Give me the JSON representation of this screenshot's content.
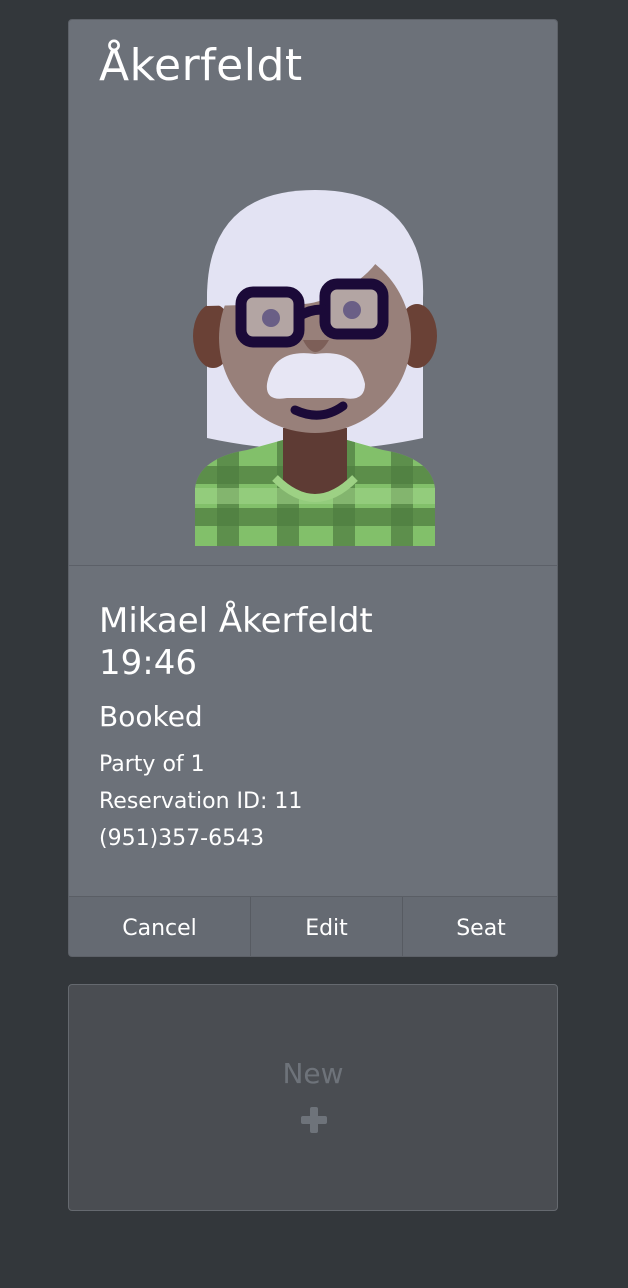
{
  "reservation_card": {
    "title": "Åkerfeldt",
    "guest_name": "Mikael Åkerfeldt",
    "time": "19:46",
    "status": "Booked",
    "party": "Party of 1",
    "reservation_id": "Reservation ID: 11",
    "phone": "(951)357-6543",
    "avatar_icon": "elderly-man-avatar-icon",
    "actions": {
      "cancel": "Cancel",
      "edit": "Edit",
      "seat": "Seat"
    }
  },
  "new_card": {
    "label": "New",
    "icon": "plus-icon"
  },
  "colors": {
    "background": "#33373b",
    "card": "#6c7179",
    "new_card": "#4a4d52",
    "text": "#ffffff",
    "muted": "#6e737a"
  }
}
